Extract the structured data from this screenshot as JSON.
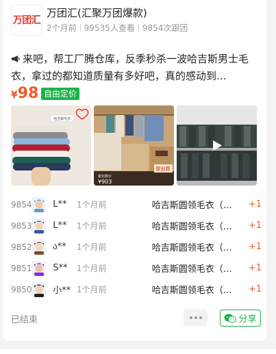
{
  "shop": {
    "logo_text": "万团汇",
    "name": "万团汇(汇聚万团爆款)",
    "posted": "2个月前",
    "views": "99535人查看",
    "participants": "9854次跟团"
  },
  "post": {
    "description": "来吧，帮工厂腾仓库，反季秒杀一波哈吉斯男士毛衣，拿过的都知道质量有多好吧，真的感动到...",
    "price_symbol": "¥",
    "price": "98",
    "price_tag": "自由定价"
  },
  "images": [
    {
      "name": "stacked-sweaters-photo"
    },
    {
      "name": "wardrobe-sweaters-photo",
      "caption_left": "¥903",
      "caption_right": "聚划算"
    },
    {
      "name": "rack-video-thumbnail",
      "icon": "play-icon"
    }
  ],
  "orders": [
    {
      "no": "9854",
      "user": "L**",
      "time": "1个月前",
      "item": "哈吉斯圆领毛衣（…",
      "qty": "+1"
    },
    {
      "no": "9853",
      "user": "L**",
      "time": "1个月前",
      "item": "哈吉斯圆领毛衣（…",
      "qty": "+1"
    },
    {
      "no": "9852",
      "user": "ა**",
      "time": "1个月前",
      "item": "哈吉斯圆领毛衣（…",
      "qty": "+1"
    },
    {
      "no": "9851",
      "user": "S**",
      "time": "1个月前",
      "item": "哈吉斯圆领毛衣（…",
      "qty": "+1"
    },
    {
      "no": "9850",
      "user": "小**",
      "time": "1个月前",
      "item": "哈吉斯圆领毛衣（…",
      "qty": "+1"
    }
  ],
  "footer": {
    "status": "已结束",
    "share_label": "分享"
  },
  "colors": {
    "accent_green": "#1bb34a",
    "price_orange": "#f15a24",
    "brand_red": "#e2382e"
  }
}
